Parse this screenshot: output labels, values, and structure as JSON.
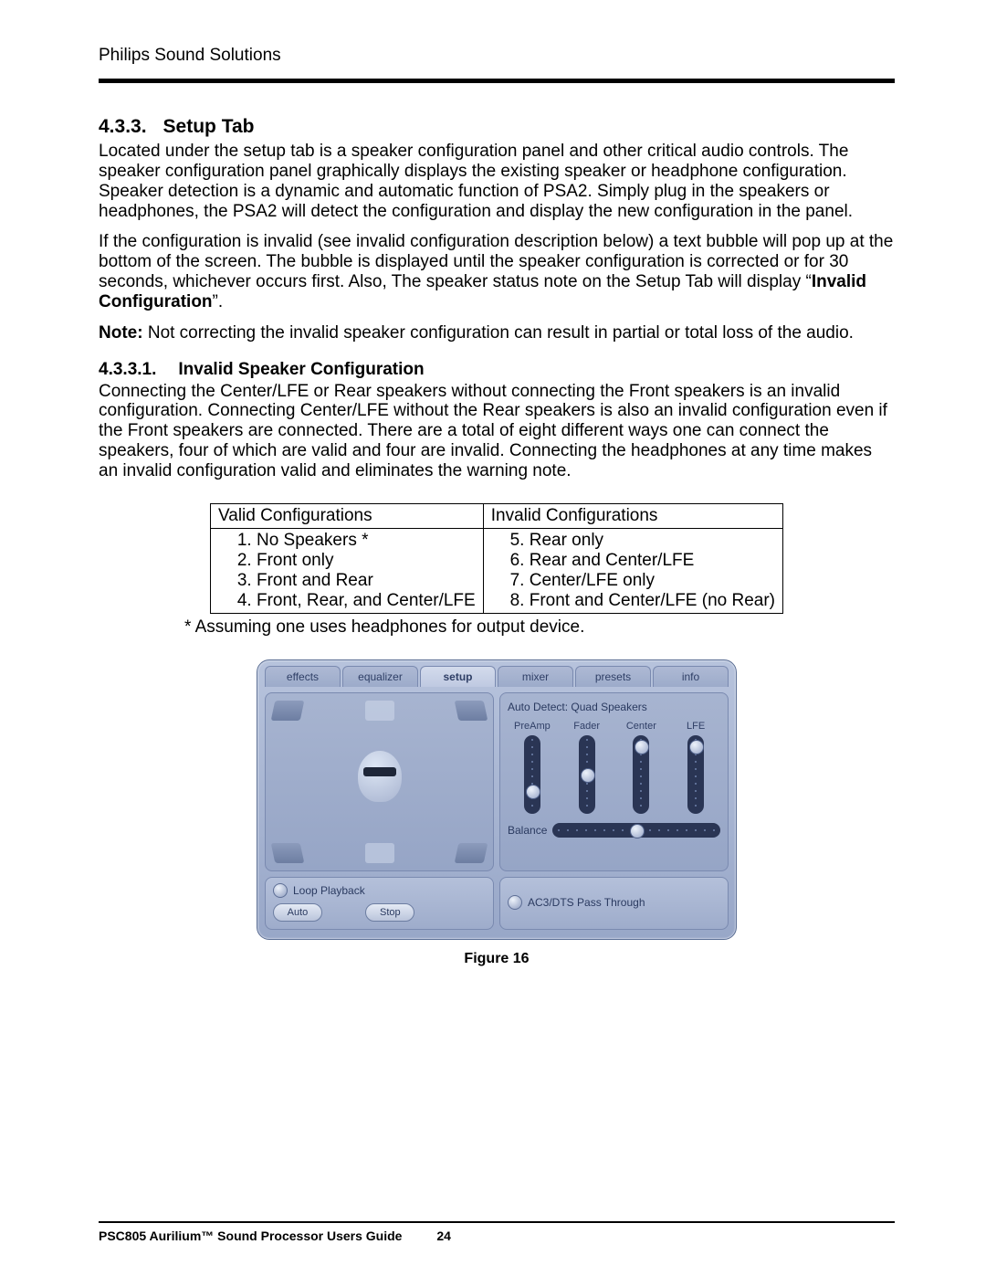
{
  "header": {
    "brand": "Philips Sound Solutions"
  },
  "sections": {
    "setup": {
      "number": "4.3.3.",
      "title": "Setup Tab",
      "p1": "Located under the setup tab is a speaker configuration panel and other critical audio controls. The speaker configuration panel graphically displays the existing speaker or headphone configuration. Speaker detection is a dynamic and automatic function of PSA2. Simply plug in the speakers or headphones, the PSA2 will detect the configuration and display the new configuration in the panel.",
      "p2_pre": "If the configuration is invalid (see invalid configuration description below) a text bubble will pop up at the bottom of the screen. The bubble is displayed until the speaker configuration is corrected or for 30 seconds, whichever occurs first. Also, The speaker status note on the Setup Tab will display “",
      "p2_bold": "Invalid Configuration",
      "p2_post": "”.",
      "p3_bold": "Note:",
      "p3_rest": " Not correcting the invalid speaker configuration can result in partial or total loss of the audio."
    },
    "invalid": {
      "number": "4.3.3.1.",
      "title": "Invalid Speaker Configuration",
      "p1": "Connecting the Center/LFE or Rear speakers without connecting the Front speakers is an invalid configuration.  Connecting Center/LFE without the Rear speakers is also an invalid configuration even if the Front speakers are connected. There are a total of eight different ways one can connect the speakers, four of which are valid and four are invalid. Connecting the headphones at any time makes an invalid configuration valid and eliminates the warning note."
    }
  },
  "table": {
    "col1_header": "Valid Configurations",
    "col2_header": "Invalid Configurations",
    "valid": [
      "No Speakers *",
      "Front only",
      "Front and Rear",
      "Front, Rear, and Center/LFE"
    ],
    "invalid_start": 5,
    "invalid": [
      "Rear only",
      "Rear and Center/LFE",
      "Center/LFE only",
      "Front and Center/LFE (no Rear)"
    ],
    "footnote": "* Assuming one uses headphones for output device."
  },
  "app": {
    "tabs": [
      "effects",
      "equalizer",
      "setup",
      "mixer",
      "presets",
      "info"
    ],
    "active_tab_index": 2,
    "auto_detect_label": "Auto Detect:",
    "auto_detect_value": "Quad Speakers",
    "sliders": [
      {
        "label": "PreAmp",
        "thumb_pct": 78
      },
      {
        "label": "Fader",
        "thumb_pct": 52
      },
      {
        "label": "Center",
        "thumb_pct": 8
      },
      {
        "label": "LFE",
        "thumb_pct": 8
      }
    ],
    "balance": {
      "label": "Balance",
      "thumb_pct": 50
    },
    "left_bottom": {
      "checkbox": "Loop Playback",
      "buttons": [
        "Auto",
        "Stop"
      ]
    },
    "right_bottom": {
      "checkbox": "AC3/DTS Pass Through"
    }
  },
  "figure_caption": "Figure 16",
  "footer": {
    "doc_title": "PSC805 Aurilium™ Sound Processor Users Guide",
    "page": "24"
  }
}
